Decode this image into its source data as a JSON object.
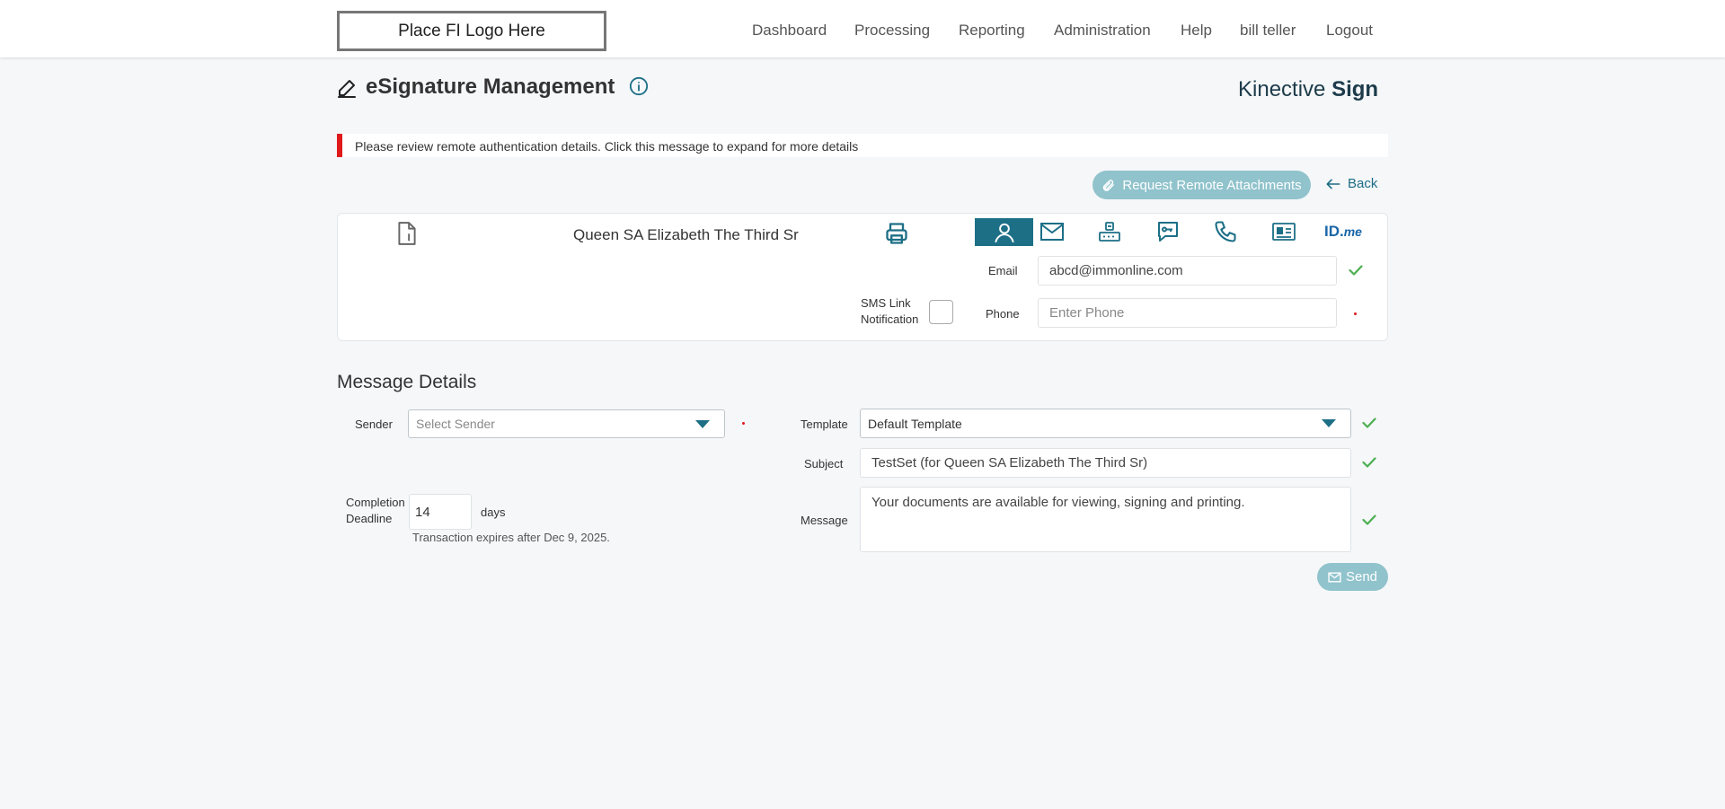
{
  "header": {
    "logo_text": "Place FI Logo Here",
    "nav": [
      "Dashboard",
      "Processing",
      "Reporting",
      "Administration",
      "Help",
      "bill teller",
      "Logout"
    ]
  },
  "page": {
    "title": "eSignature Management",
    "brand_light": "Kinective ",
    "brand_bold": "Sign"
  },
  "alert": {
    "text": "Please review remote authentication details. Click this message to expand for more details"
  },
  "actions": {
    "request_label": "Request Remote Attachments",
    "back_label": "Back"
  },
  "signer": {
    "name": "Queen SA Elizabeth The Third Sr",
    "auth_methods": [
      "person-icon",
      "email-icon",
      "router-icon",
      "chat-key-icon",
      "phone-icon",
      "id-card-icon",
      "idme-icon"
    ],
    "idme_text_1": "ID.",
    "idme_text_2": "me",
    "email_label": "Email",
    "email_value": "abcd@immonline.com",
    "sms_label_1": "SMS Link",
    "sms_label_2": "Notification",
    "phone_label": "Phone",
    "phone_placeholder": "Enter Phone"
  },
  "message_details": {
    "title": "Message Details",
    "sender_label": "Sender",
    "sender_placeholder": "Select Sender",
    "deadline_label_1": "Completion",
    "deadline_label_2": "Deadline",
    "deadline_value": "14",
    "deadline_unit": "days",
    "expires_text": "Transaction expires after Dec 9, 2025.",
    "template_label": "Template",
    "template_value": "Default Template",
    "subject_label": "Subject",
    "subject_value": "TestSet (for Queen SA Elizabeth The Third Sr)",
    "message_label": "Message",
    "message_value": "Your documents are available for viewing, signing and printing.",
    "send_label": "Send"
  },
  "colors": {
    "accent": "#1d6f86",
    "button_disabled": "#90c3cc",
    "alert_red": "#e0191b",
    "check_green": "#4caf50"
  }
}
